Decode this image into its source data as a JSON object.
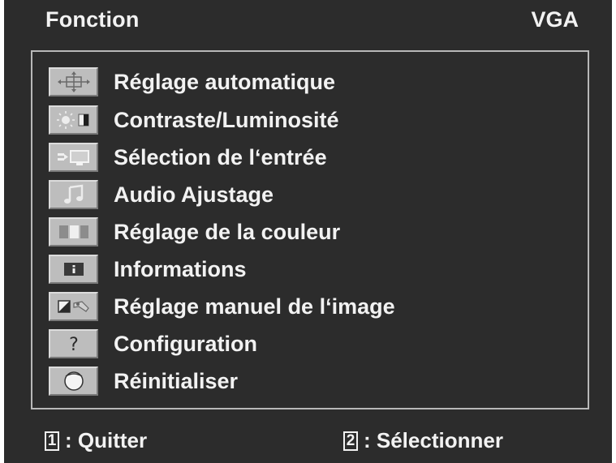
{
  "header": {
    "title": "Fonction",
    "source": "VGA"
  },
  "menu": {
    "items": [
      {
        "label": "Réglage automatique",
        "icon": "auto-adjust-icon"
      },
      {
        "label": "Contraste/Luminosité",
        "icon": "contrast-brightness-icon"
      },
      {
        "label": "Sélection de l‘entrée",
        "icon": "input-select-icon"
      },
      {
        "label": "Audio Ajustage",
        "icon": "audio-icon"
      },
      {
        "label": "Réglage de la couleur",
        "icon": "color-adjust-icon"
      },
      {
        "label": "Informations",
        "icon": "info-icon"
      },
      {
        "label": "Réglage manuel de l‘image",
        "icon": "manual-image-icon"
      },
      {
        "label": "Configuration",
        "icon": "question-icon"
      },
      {
        "label": "Réinitialiser",
        "icon": "reset-icon"
      }
    ]
  },
  "footer": {
    "quit_key": "1",
    "quit_label": ": Quitter",
    "select_key": "2",
    "select_label": ": Sélectionner"
  },
  "colors": {
    "background": "#2c2c2c",
    "text": "#f2f2f2",
    "icon_tile": "#bdbdbd"
  }
}
